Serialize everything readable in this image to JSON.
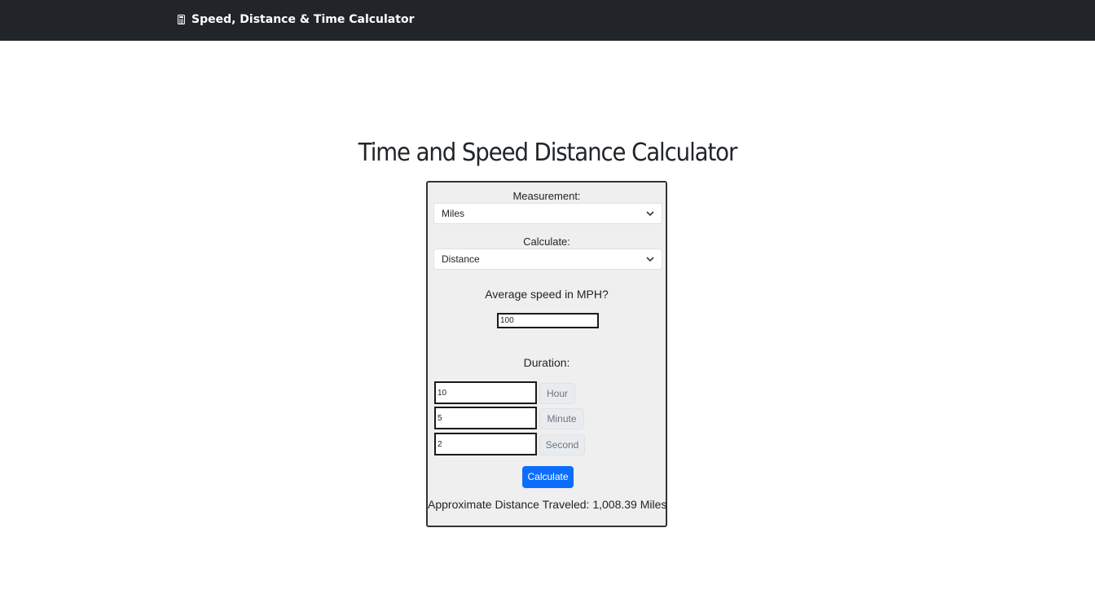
{
  "navbar": {
    "brand_icon": "calculator-icon",
    "brand_label": "Speed, Distance & Time Calculator",
    "background": "#212529"
  },
  "page": {
    "title": "Time and Speed Distance Calculator"
  },
  "form": {
    "measurement_label": "Measurement:",
    "measurement_value": "Miles",
    "calculate_label": "Calculate:",
    "calculate_value": "Distance",
    "speed_label": "Average speed in MPH?",
    "speed_value": "100",
    "duration_label": "Duration:",
    "hours_value": "10",
    "hours_unit": "Hour",
    "minutes_value": "5",
    "minutes_unit": "Minute",
    "seconds_value": "2",
    "seconds_unit": "Second",
    "calculate_button": "Calculate",
    "result_text": "Approximate Distance Traveled: 1,008.39 Miles"
  },
  "colors": {
    "primary_button": "#0d6efd",
    "card_background": "#efefef"
  }
}
